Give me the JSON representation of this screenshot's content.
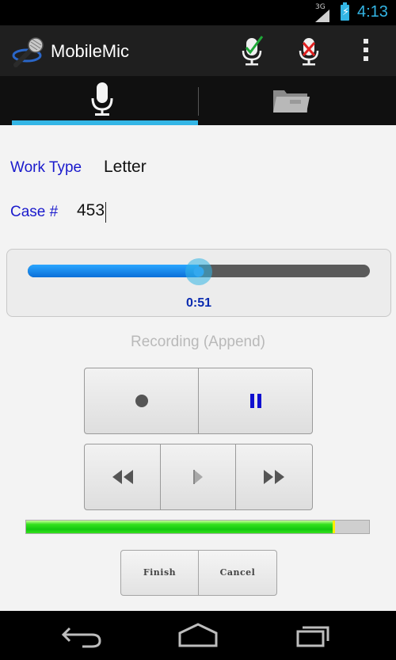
{
  "status_bar": {
    "network": "3G",
    "time": "4:13"
  },
  "action_bar": {
    "title": "MobileMic",
    "icons": [
      "microphone-logo-icon",
      "mic-check-icon",
      "mic-delete-icon",
      "overflow-menu-icon"
    ]
  },
  "tabs": [
    {
      "icon": "microphone-icon",
      "selected": true
    },
    {
      "icon": "folder-icon",
      "selected": false
    }
  ],
  "form": {
    "work_type_label": "Work Type",
    "work_type_value": "Letter",
    "case_label": "Case #",
    "case_value": "453"
  },
  "seek": {
    "time": "0:51",
    "position_fraction": 0.5
  },
  "recording_status": "Recording (Append)",
  "transport": {
    "row1": [
      "record-icon",
      "pause-icon"
    ],
    "row2": [
      "rewind-icon",
      "play-icon",
      "fast-forward-icon"
    ]
  },
  "level_meter": {
    "fraction": 0.9
  },
  "actions": {
    "finish_label": "Finish",
    "cancel_label": "Cancel"
  },
  "nav": [
    "back-icon",
    "home-icon",
    "recents-icon"
  ],
  "colors": {
    "accent": "#33b5e5",
    "label_blue": "#1a1acc",
    "time_blue": "#0a2bb0"
  }
}
